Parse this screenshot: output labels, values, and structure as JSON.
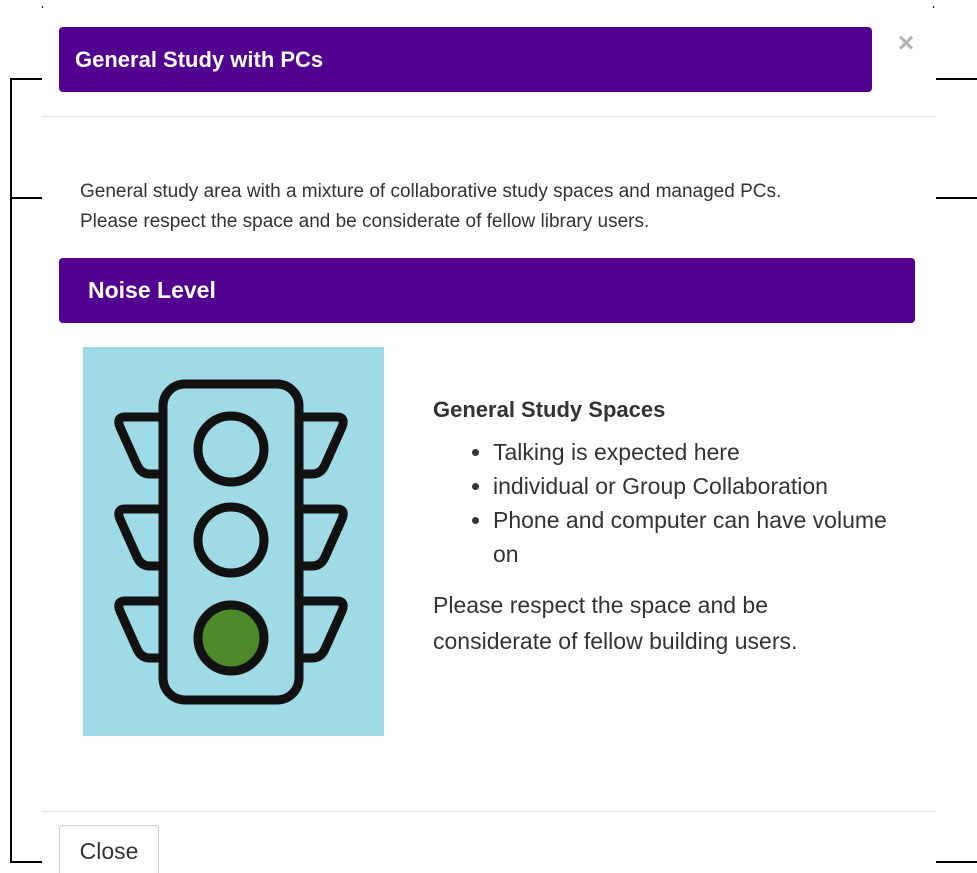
{
  "modal": {
    "title": "General Study with PCs",
    "close_icon": "close-icon",
    "close_glyph": "×",
    "description_lines": [
      "General study area with a mixture of collaborative study spaces and managed PCs.",
      "Please respect the space and be considerate of fellow library users."
    ],
    "noise_section": {
      "heading": "Noise Level",
      "image_icon": "traffic-light-icon",
      "active_light": "green",
      "colors": {
        "header_bg": "#51008f",
        "image_bg": "#9edbe6",
        "green_light": "#4e8a2b"
      },
      "subheading": "General Study Spaces",
      "bullets": [
        "Talking is expected here",
        "individual or Group Collaboration",
        "Phone and computer can have volume on"
      ],
      "note": "Please respect the space and be considerate of fellow building users."
    },
    "footer": {
      "close_label": "Close"
    }
  }
}
